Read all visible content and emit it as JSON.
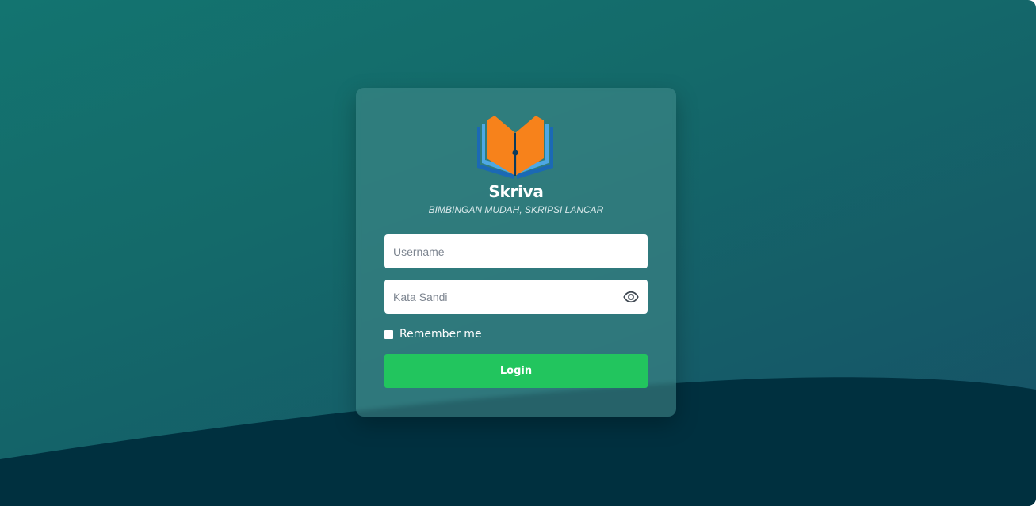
{
  "brand": {
    "name": "Skriva",
    "tagline": "BIMBINGAN MUDAH, SKRIPSI LANCAR",
    "logo_icon": "book-pen-logo"
  },
  "form": {
    "username_placeholder": "Username",
    "password_placeholder": "Kata Sandi",
    "show_password_icon": "eye-icon",
    "remember_label": "Remember me",
    "remember_checked": false,
    "login_label": "Login"
  },
  "colors": {
    "background_top": "#137470",
    "background_bottom_wave": "#00303f",
    "login_button": "#22c55e",
    "logo_orange": "#f7821b",
    "logo_blue": "#1b69b5",
    "logo_light_blue": "#4ea8e4"
  }
}
